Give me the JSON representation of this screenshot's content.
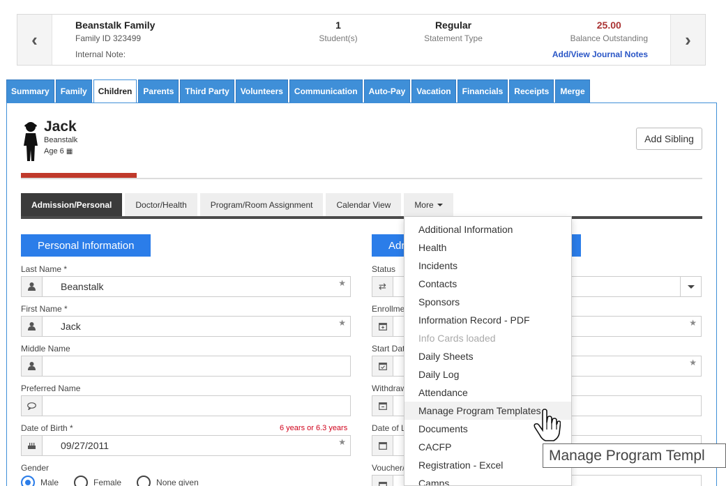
{
  "family": {
    "name": "Beanstalk Family",
    "family_id": "Family ID 323499",
    "internal_note": "Internal Note:",
    "students_value": "1",
    "students_label": "Student(s)",
    "statement_value": "Regular",
    "statement_label": "Statement Type",
    "balance_value": "25.00",
    "balance_label": "Balance Outstanding",
    "journal_link": "Add/View Journal Notes"
  },
  "main_tabs": [
    {
      "label": "Summary"
    },
    {
      "label": "Family"
    },
    {
      "label": "Children",
      "active": true
    },
    {
      "label": "Parents"
    },
    {
      "label": "Third Party"
    },
    {
      "label": "Volunteers"
    },
    {
      "label": "Communication"
    },
    {
      "label": "Auto-Pay"
    },
    {
      "label": "Vacation"
    },
    {
      "label": "Financials"
    },
    {
      "label": "Receipts"
    },
    {
      "label": "Merge"
    }
  ],
  "child": {
    "first_name": "Jack",
    "last_name": "Beanstalk",
    "age": "Age 6",
    "add_sibling": "Add Sibling",
    "progress": 0.17
  },
  "sub_tabs": [
    {
      "label": "Admission/Personal",
      "active": true
    },
    {
      "label": "Doctor/Health"
    },
    {
      "label": "Program/Room Assignment"
    },
    {
      "label": "Calendar View"
    },
    {
      "label": "More"
    }
  ],
  "personal": {
    "header": "Personal Information",
    "last_name_label": "Last Name *",
    "last_name_value": "Beanstalk",
    "first_name_label": "First Name *",
    "first_name_value": "Jack",
    "middle_name_label": "Middle Name",
    "preferred_name_label": "Preferred Name",
    "dob_label": "Date of Birth *",
    "dob_hint": "6 years or 6.3 years",
    "dob_value": "09/27/2011",
    "gender_label": "Gender",
    "gender_options": [
      "Male",
      "Female",
      "None given"
    ],
    "gender_selected": "Male"
  },
  "admission": {
    "header_visible": "Adr",
    "status_label": "Status",
    "enrollment_label": "Enrollme",
    "start_label": "Start Dat",
    "withdraw_label": "Withdraw",
    "last_label": "Date of L",
    "voucher_label": "Voucher/"
  },
  "more_menu": {
    "items": [
      {
        "label": "Additional Information"
      },
      {
        "label": "Health"
      },
      {
        "label": "Incidents"
      },
      {
        "label": "Contacts"
      },
      {
        "label": "Sponsors"
      },
      {
        "label": "Information Record - PDF"
      },
      {
        "label": "Info Cards loaded",
        "disabled": true
      },
      {
        "label": "Daily Sheets"
      },
      {
        "label": "Daily Log"
      },
      {
        "label": "Attendance"
      },
      {
        "label": "Manage Program Templates",
        "hover": true
      },
      {
        "label": "Documents"
      },
      {
        "label": "CACFP"
      },
      {
        "label": "Registration - Excel"
      },
      {
        "label": "Camps"
      }
    ]
  },
  "tooltip": "Manage Program Templ",
  "colors": {
    "tab_blue": "#3f8fd8",
    "section_blue": "#2b7de9",
    "balance_red": "#a33333",
    "progress_red": "#c0392b",
    "link_blue": "#2a56c6"
  }
}
